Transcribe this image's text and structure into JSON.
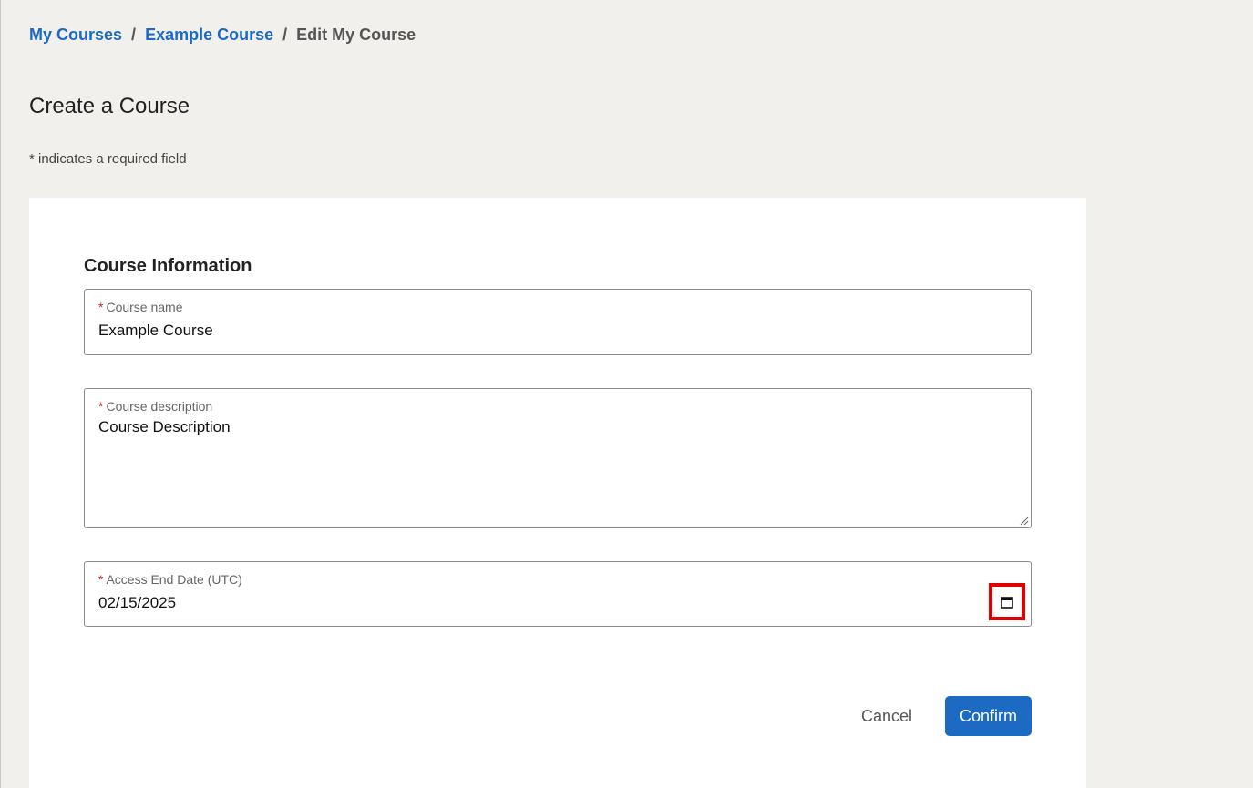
{
  "breadcrumb": {
    "items": [
      "My Courses",
      "Example Course"
    ],
    "current": "Edit My Course",
    "separator": "/"
  },
  "page": {
    "title": "Create a Course",
    "required_note": "* indicates a required field"
  },
  "form": {
    "section_title": "Course Information",
    "required_marker": "*",
    "course_name": {
      "label": "Course name",
      "value": "Example Course"
    },
    "course_description": {
      "label": "Course description",
      "value": "Course Description"
    },
    "access_end_date": {
      "label": "Access End Date (UTC)",
      "value": "02/15/2025",
      "icon": "calendar-icon"
    }
  },
  "actions": {
    "cancel_label": "Cancel",
    "confirm_label": "Confirm"
  },
  "colors": {
    "link": "#1d6ac3",
    "primary": "#1d6ac3",
    "required": "#c0272d",
    "highlight": "#e00000",
    "background": "#f1f0ec"
  }
}
